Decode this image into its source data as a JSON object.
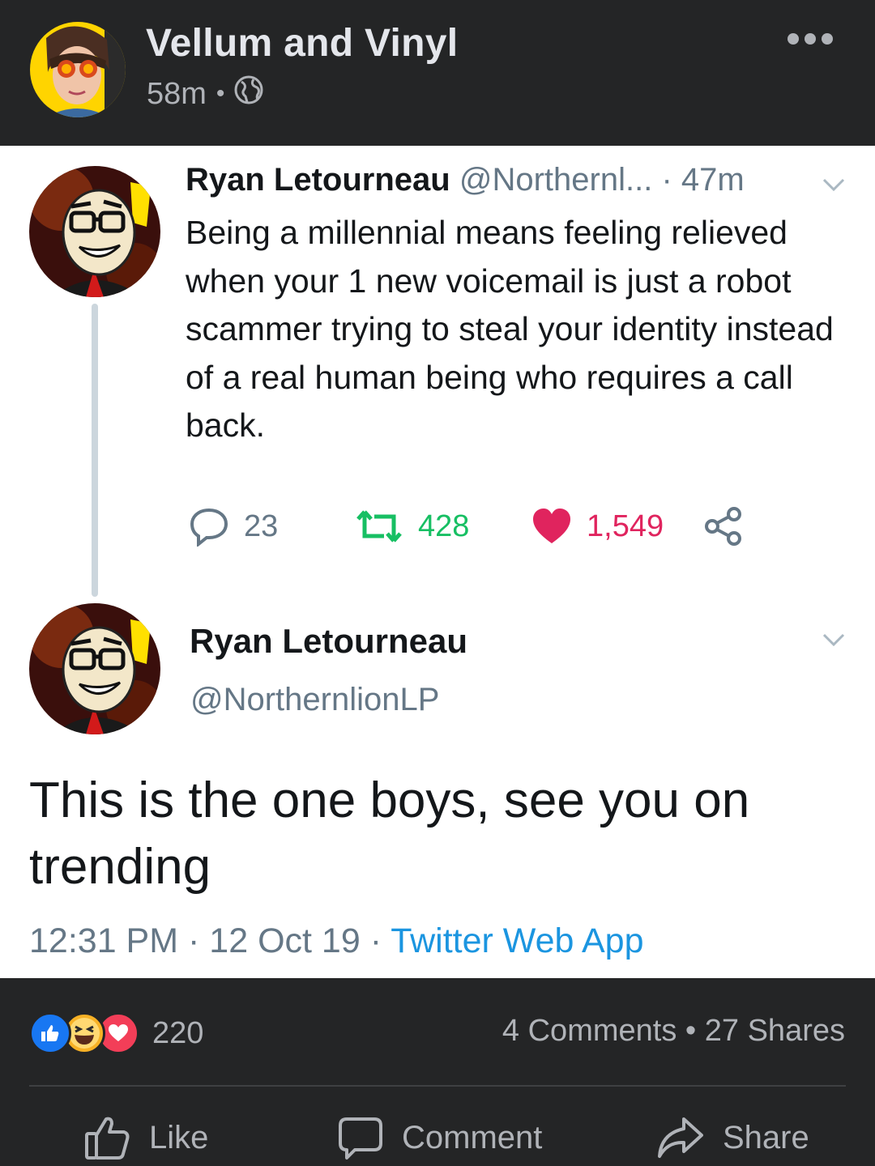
{
  "post": {
    "page_name": "Vellum and Vinyl",
    "time_ago": "58m",
    "separator": "•",
    "privacy_icon": "globe-icon",
    "more_icon": "ellipsis-icon"
  },
  "tweet1": {
    "name": "Ryan Letourneau",
    "handle": "@Northernl...",
    "time": "· 47m",
    "text": "Being a millennial means feeling relieved when your 1 new voicemail is just a robot scammer trying to steal your identity instead of a real human being who requires a call back.",
    "replies": "23",
    "retweets": "428",
    "likes": "1,549",
    "colors": {
      "retweet": "#17bf63",
      "like": "#e0245e",
      "reply": "#657786"
    }
  },
  "tweet2": {
    "name": "Ryan Letourneau",
    "handle": "@NorthernlionLP",
    "text": "This is the one boys, see you on trending",
    "time": "12:31 PM",
    "date": "12 Oct 19",
    "meta_sep": "·",
    "source": "Twitter Web App"
  },
  "footer": {
    "reaction_icons": [
      "like-reaction-icon",
      "haha-reaction-icon",
      "love-reaction-icon"
    ],
    "reaction_count": "220",
    "comments": "4 Comments",
    "shares": "27 Shares",
    "stats_sep": "•",
    "like_label": "Like",
    "comment_label": "Comment",
    "share_label": "Share"
  }
}
